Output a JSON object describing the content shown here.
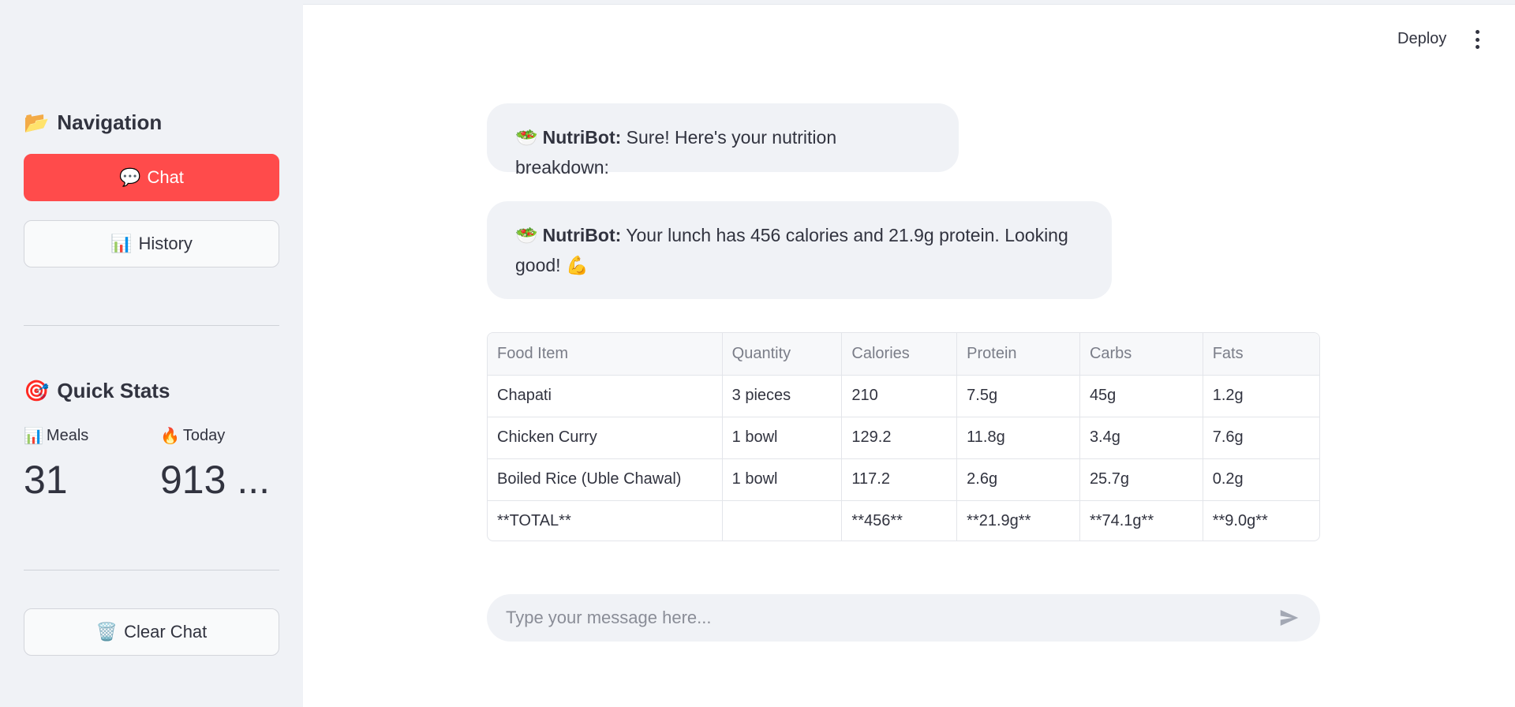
{
  "header": {
    "deploy_label": "Deploy",
    "menu_icon": "kebab-menu-icon"
  },
  "sidebar": {
    "navigation": {
      "emoji": "📂",
      "title": "Navigation"
    },
    "chat_button": {
      "emoji": "💬",
      "label": "Chat"
    },
    "history_button": {
      "emoji": "📊",
      "label": "History"
    },
    "quick_stats": {
      "emoji": "🎯",
      "title": "Quick Stats"
    },
    "metrics": [
      {
        "emoji": "📊",
        "label": "Meals",
        "value": "31"
      },
      {
        "emoji": "🔥",
        "label": "Today",
        "value": "913 ..."
      }
    ],
    "clear_button": {
      "emoji": "🗑️",
      "label": "Clear Chat"
    }
  },
  "chat": {
    "messages": [
      {
        "emoji": "🥗",
        "sender": "NutriBot:",
        "text": " Sure! Here's your nutrition breakdown:"
      },
      {
        "emoji": "🥗",
        "sender": "NutriBot:",
        "text": " Your lunch has 456 calories and 21.9g protein. Looking good! 💪"
      }
    ],
    "table": {
      "headers": [
        "Food Item",
        "Quantity",
        "Calories",
        "Protein",
        "Carbs",
        "Fats"
      ],
      "rows": [
        [
          "Chapati",
          "3 pieces",
          "210",
          "7.5g",
          "45g",
          "1.2g"
        ],
        [
          "Chicken Curry",
          "1 bowl",
          "129.2",
          "11.8g",
          "3.4g",
          "7.6g"
        ],
        [
          "Boiled Rice (Uble Chawal)",
          "1 bowl",
          "117.2",
          "2.6g",
          "25.7g",
          "0.2g"
        ],
        [
          "**TOTAL**",
          "",
          "**456**",
          "**21.9g**",
          "**74.1g**",
          "**9.0g**"
        ]
      ]
    },
    "input": {
      "placeholder": "Type your message here...",
      "value": ""
    },
    "send_icon": "send-icon"
  },
  "colors": {
    "accent": "#ff4b4b",
    "sidebar_bg": "#f0f2f6",
    "text": "#31333f"
  }
}
